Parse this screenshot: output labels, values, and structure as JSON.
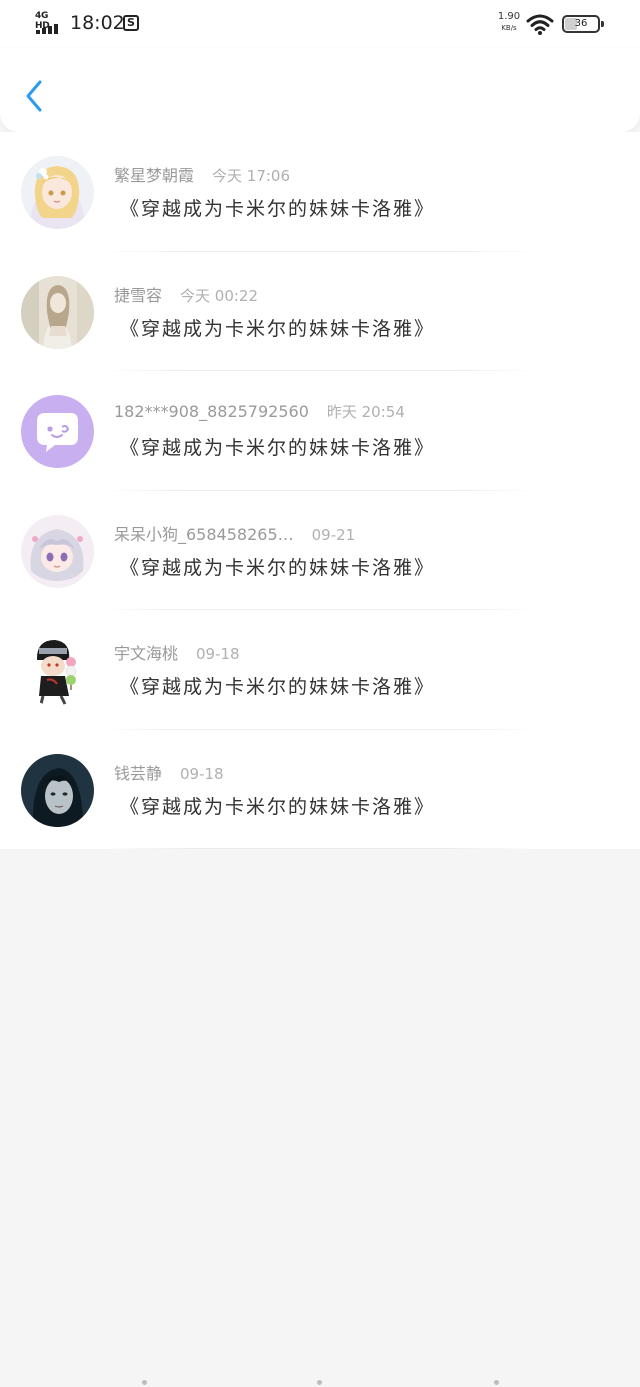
{
  "status_bar": {
    "network": "4G HD",
    "time": "18:02",
    "notification_icon": "s-box-icon",
    "speed_value": "1.90",
    "speed_unit": "KB/s",
    "battery": "36"
  },
  "header": {
    "back_icon": "chevron-left-icon",
    "accent_color": "#2a9bf0"
  },
  "messages": [
    {
      "name": "繁星梦朝霞",
      "time": "今天 17:06",
      "text": "《穿越成为卡米尔的妹妹卡洛雅》",
      "avatar": "anime-girl-blonde-avatar"
    },
    {
      "name": "捷雪容",
      "time": "今天 00:22",
      "text": "《穿越成为卡米尔的妹妹卡洛雅》",
      "avatar": "doll-photo-avatar"
    },
    {
      "name": "182***908_8825792560",
      "time": "昨天 20:54",
      "text": "《穿越成为卡米尔的妹妹卡洛雅》",
      "avatar": "chat-bubble-avatar"
    },
    {
      "name": "呆呆小狗_658458265…",
      "time": "09-21",
      "text": "《穿越成为卡米尔的妹妹卡洛雅》",
      "avatar": "anime-girl-silver-avatar"
    },
    {
      "name": "宇文海桃",
      "time": "09-18",
      "text": "《穿越成为卡米尔的妹妹卡洛雅》",
      "avatar": "chibi-ninja-avatar"
    },
    {
      "name": "钱芸静",
      "time": "09-18",
      "text": "《穿越成为卡米尔的妹妹卡洛雅》",
      "avatar": "dark-portrait-avatar"
    }
  ]
}
